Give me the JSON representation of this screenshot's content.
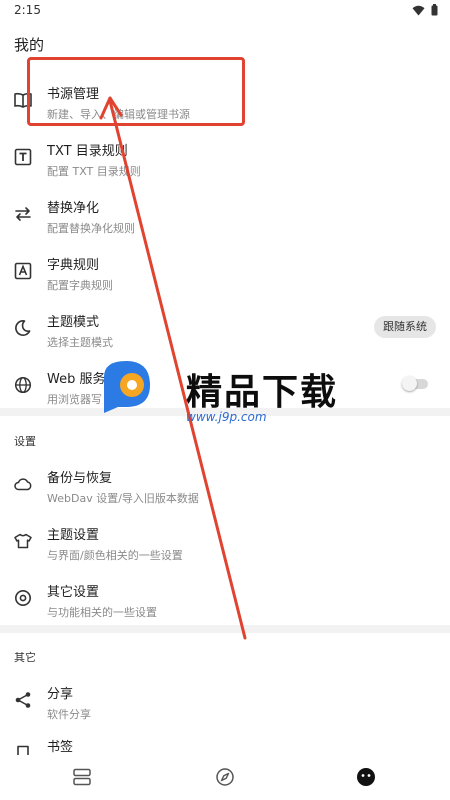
{
  "status_bar": {
    "time": "2:15"
  },
  "page_title": "我的",
  "main_items": [
    {
      "title": "书源管理",
      "subtitle": "新建、导入、编辑或管理书源",
      "icon": "book-open-icon"
    },
    {
      "title": "TXT 目录规则",
      "subtitle": "配置 TXT 目录规则",
      "icon": "txt-box-icon"
    },
    {
      "title": "替换净化",
      "subtitle": "配置替换净化规则",
      "icon": "swap-icon"
    },
    {
      "title": "字典规则",
      "subtitle": "配置字典规则",
      "icon": "dictionary-icon"
    },
    {
      "title": "主题模式",
      "subtitle": "选择主题模式",
      "icon": "theme-icon",
      "chip": "跟随系统"
    },
    {
      "title": "Web 服务",
      "subtitle": "用浏览器写",
      "icon": "globe-icon",
      "switch_on": false
    }
  ],
  "settings_header": "设置",
  "settings_items": [
    {
      "title": "备份与恢复",
      "subtitle": "WebDav 设置/导入旧版本数据",
      "icon": "cloud-icon"
    },
    {
      "title": "主题设置",
      "subtitle": "与界面/颜色相关的一些设置",
      "icon": "shirt-icon"
    },
    {
      "title": "其它设置",
      "subtitle": "与功能相关的一些设置",
      "icon": "settings-circle-icon"
    }
  ],
  "other_header": "其它",
  "other_items": [
    {
      "title": "分享",
      "subtitle": "软件分享",
      "icon": "share-icon"
    },
    {
      "title": "书签",
      "subtitle": "",
      "icon": "bookmark-icon"
    }
  ],
  "watermark": {
    "text": "精品下载",
    "url": "www.j9p.com"
  },
  "bottom_nav": [
    {
      "icon": "bookshelf-icon"
    },
    {
      "icon": "compass-icon"
    },
    {
      "icon": "profile-face-icon",
      "active": true
    }
  ],
  "colors": {
    "highlight": "#e0432f",
    "watermark_blue": "#2c7be5",
    "watermark_orange": "#f5a623"
  }
}
